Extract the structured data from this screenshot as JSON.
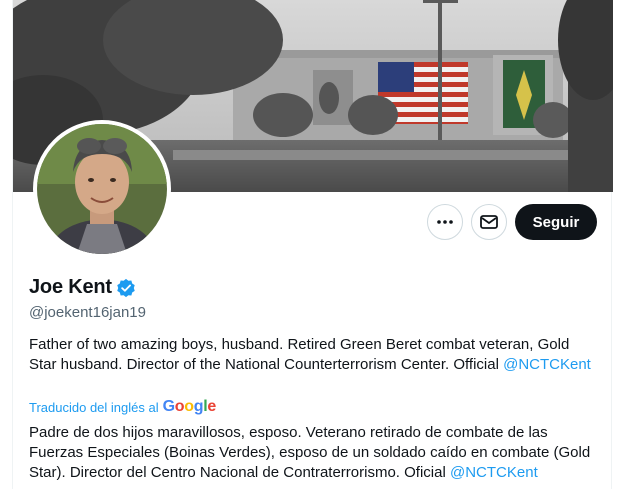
{
  "profile": {
    "display_name": "Joe Kent",
    "handle": "@joekent16jan19",
    "verified_color": "#1d9bf0"
  },
  "actions": {
    "more_icon": "more-horizontal-icon",
    "message_icon": "envelope-icon",
    "follow_label": "Seguir"
  },
  "bio": {
    "original_text": "Father of two amazing boys, husband. Retired Green Beret combat veteran, Gold Star husband. Director of the National Counterterrorism Center. Official",
    "original_mention": "@NCTCKent",
    "translated_label": "Traducido del inglés al",
    "google_letters": [
      "G",
      "o",
      "o",
      "g",
      "l",
      "e"
    ],
    "translated_text": "Padre de dos hijos maravillosos, esposo. Veterano retirado de combate de las Fuerzas Especiales (Boinas Verdes), esposo de un soldado caído en combate (Gold Star). Director del Centro Nacional de Contraterrorismo. Oficial",
    "translated_mention": "@NCTCKent"
  },
  "colors": {
    "accent": "#1d9bf0",
    "text_primary": "#0f1419",
    "text_secondary": "#536471",
    "follow_bg": "#0f1419"
  }
}
